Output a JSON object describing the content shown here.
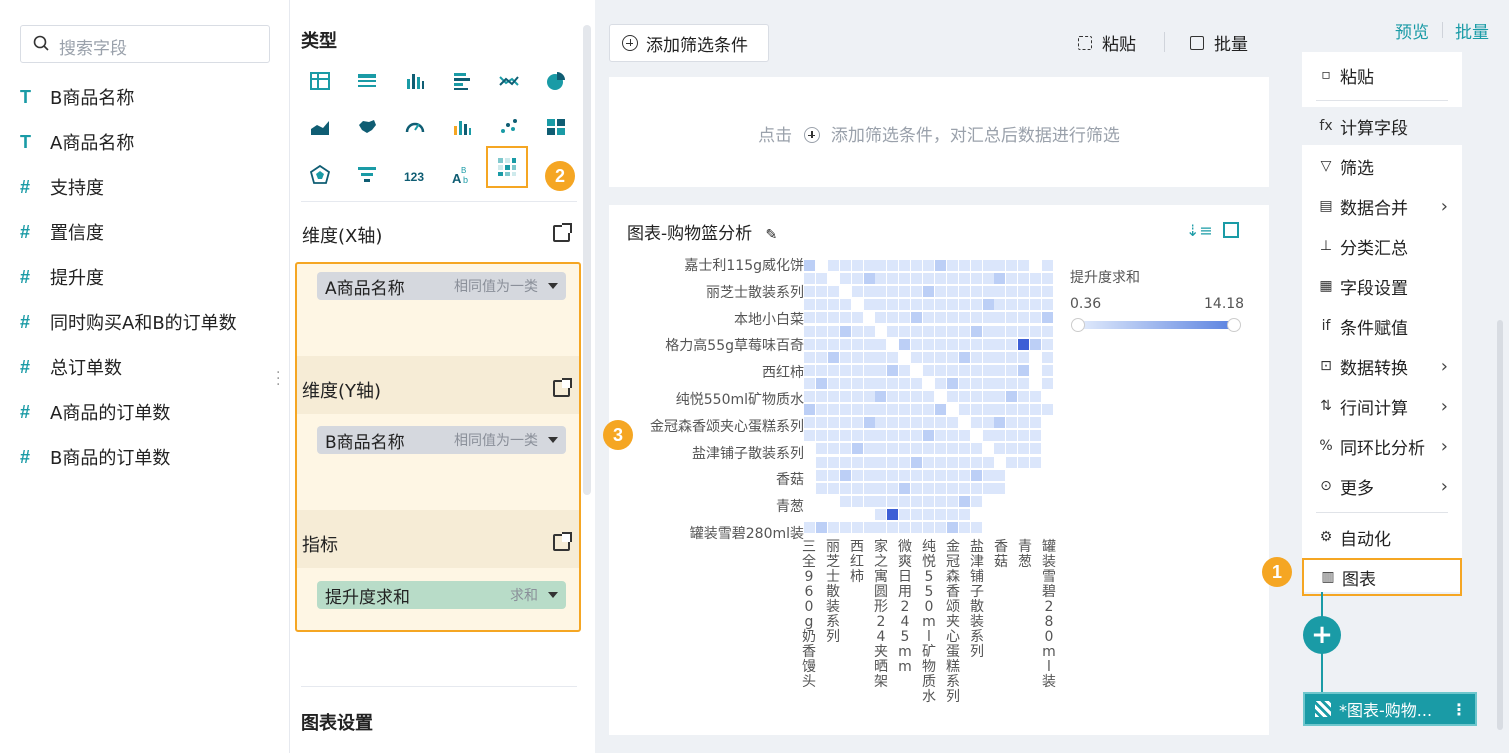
{
  "search": {
    "placeholder": "搜索字段"
  },
  "fields": [
    {
      "icon": "T",
      "name": "B商品名称"
    },
    {
      "icon": "T",
      "name": "A商品名称"
    },
    {
      "icon": "#",
      "name": "支持度"
    },
    {
      "icon": "#",
      "name": "置信度"
    },
    {
      "icon": "#",
      "name": "提升度"
    },
    {
      "icon": "#",
      "name": "同时购买A和B的订单数"
    },
    {
      "icon": "#",
      "name": "总订单数"
    },
    {
      "icon": "#",
      "name": "A商品的订单数"
    },
    {
      "icon": "#",
      "name": "B商品的订单数"
    }
  ],
  "types_panel": {
    "title": "类型",
    "badge": "2",
    "x_axis_label": "维度(X轴)",
    "y_axis_label": "维度(Y轴)",
    "measure_label": "指标",
    "chart_settings_label": "图表设置",
    "x_pill": {
      "field": "A商品名称",
      "hint": "相同值为一类"
    },
    "y_pill": {
      "field": "B商品名称",
      "hint": "相同值为一类"
    },
    "m_pill": {
      "field": "提升度求和",
      "hint": "求和"
    }
  },
  "toolbar": {
    "add_filter": "添加筛选条件",
    "paste": "粘贴",
    "batch": "批量",
    "filter_hint_prefix": "点击",
    "filter_hint_suffix": "添加筛选条件，对汇总后数据进行筛选"
  },
  "chart": {
    "title": "图表-购物篮分析",
    "badge": "3",
    "legend_title": "提升度求和",
    "legend_min": "0.36",
    "legend_max": "14.18",
    "y_labels": [
      "嘉士利115g威化饼",
      "丽芝士散装系列",
      "本地小白菜",
      "格力高55g草莓味百奇",
      "西红柿",
      "纯悦550ml矿物质水",
      "金冠森香颂夹心蛋糕系列",
      "盐津铺子散装系列",
      "香菇",
      "青葱",
      "罐装雪碧280ml装"
    ],
    "x_labels": [
      "三全960g奶香馒头",
      "丽芝士散装系列",
      "西红柿",
      "家之寓圆形24夹晒架",
      "微爽日用245mm",
      "纯悦550ml矿物质水",
      "金冠森香颂夹心蛋糕系列",
      "盐津铺子散装系列",
      "香菇",
      "青葱",
      "罐装雪碧280ml装"
    ]
  },
  "chart_data": {
    "type": "heatmap",
    "title": "图表-购物篮分析",
    "value_name": "提升度求和",
    "color_range": [
      0.36,
      14.18
    ],
    "y_categories_visible": [
      "嘉士利115g威化饼",
      "丽芝士散装系列",
      "本地小白菜",
      "格力高55g草莓味百奇",
      "西红柿",
      "纯悦550ml矿物质水",
      "金冠森香颂夹心蛋糕系列",
      "盐津铺子散装系列",
      "香菇",
      "青葱",
      "罐装雪碧280ml装"
    ],
    "x_categories_visible": [
      "三全960g奶香馒头",
      "丽芝士散装系列",
      "西红柿",
      "家之寓圆形24夹晒架",
      "微爽日用245mm",
      "纯悦550ml矿物质水",
      "金冠森香颂夹心蛋糕系列",
      "盐津铺子散装系列",
      "香菇",
      "青葱",
      "罐装雪碧280ml装"
    ]
  },
  "right_panel": {
    "preview": "预览",
    "batch": "批量",
    "badge": "1",
    "menu": [
      {
        "icon": "▫",
        "label": "粘贴",
        "arrow": false
      },
      {
        "icon": "fx",
        "label": "计算字段",
        "arrow": false
      },
      {
        "icon": "▽",
        "label": "筛选",
        "arrow": false
      },
      {
        "icon": "▤",
        "label": "数据合并",
        "arrow": true
      },
      {
        "icon": "⊥",
        "label": "分类汇总",
        "arrow": false
      },
      {
        "icon": "▦",
        "label": "字段设置",
        "arrow": false
      },
      {
        "icon": "if",
        "label": "条件赋值",
        "arrow": false
      },
      {
        "icon": "⊡",
        "label": "数据转换",
        "arrow": true
      },
      {
        "icon": "⇅",
        "label": "行间计算",
        "arrow": true
      },
      {
        "icon": "%",
        "label": "同环比分析",
        "arrow": true
      },
      {
        "icon": "⊙",
        "label": "更多",
        "arrow": true
      },
      {
        "icon": "⚙",
        "label": "自动化",
        "arrow": false
      },
      {
        "icon": "▥",
        "label": "图表",
        "arrow": false
      }
    ],
    "add_symbol": "+",
    "node_label": "*图表-购物...",
    "node_more": "⋮"
  },
  "colors": {
    "accent": "#1a9ba6",
    "highlight": "#f5a623",
    "heat_low": "#dbe6fb",
    "heat_high": "#3d5fd6"
  }
}
